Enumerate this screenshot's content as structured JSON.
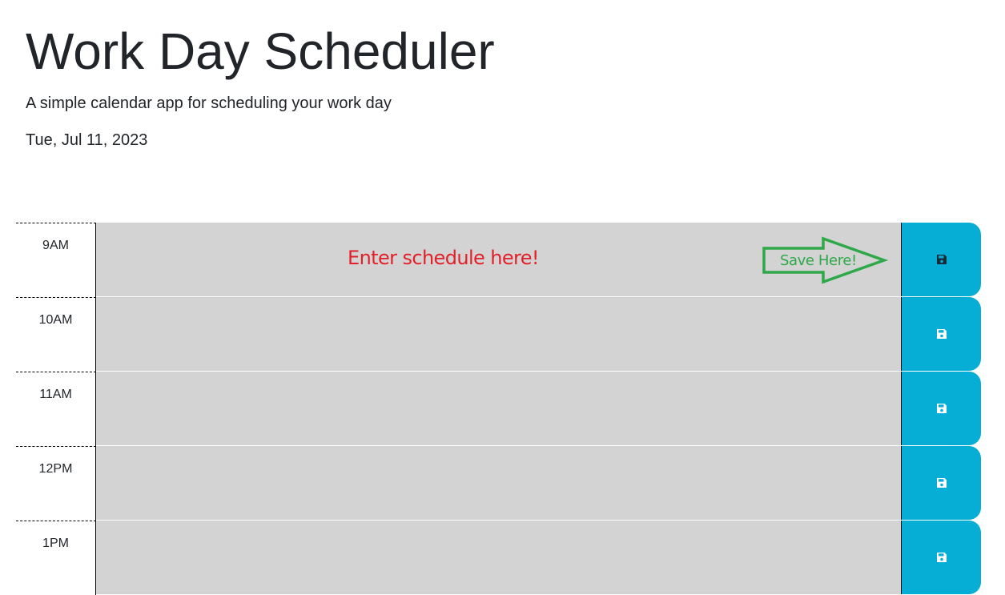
{
  "header": {
    "title": "Work Day Scheduler",
    "subtitle": "A simple calendar app for scheduling your work day",
    "date": "Tue, Jul 11, 2023"
  },
  "timeblocks": [
    {
      "hour": "9AM",
      "text": ""
    },
    {
      "hour": "10AM",
      "text": ""
    },
    {
      "hour": "11AM",
      "text": ""
    },
    {
      "hour": "12PM",
      "text": ""
    },
    {
      "hour": "1PM",
      "text": ""
    }
  ],
  "annotations": {
    "enter_hint": "Enter schedule here!",
    "save_hint": "Save Here!",
    "enter_color": "#e3202a",
    "save_color": "#2fa84a"
  },
  "colors": {
    "block_bg": "#d3d3d3",
    "save_button_bg": "#06aed5"
  },
  "icons": {
    "save": "floppy-disk-icon"
  }
}
